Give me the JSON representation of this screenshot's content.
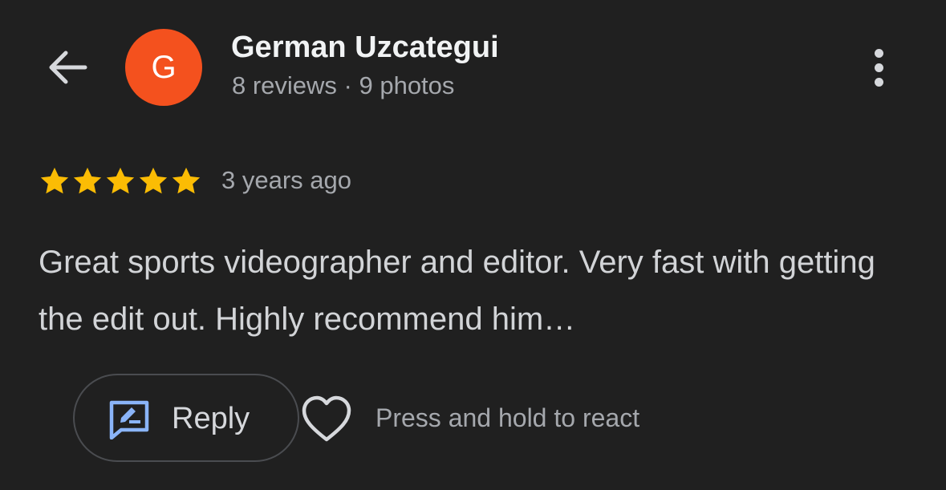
{
  "header": {
    "back_icon": "arrow-back-icon",
    "avatar_letter": "G",
    "avatar_color": "#f4511e",
    "name": "German Uzcategui",
    "meta": "8 reviews · 9 photos",
    "more_icon": "more-vert-icon"
  },
  "review": {
    "rating": 5,
    "rating_max": 5,
    "star_color": "#fbbc04",
    "time": "3 years ago",
    "text": "Great sports videographer and editor. Very fast with getting the edit out. Highly recommend him…"
  },
  "actions": {
    "reply_label": "Reply",
    "reply_icon": "reply-edit-icon",
    "reply_icon_color": "#8ab4f8",
    "heart_icon": "heart-outline-icon",
    "react_hint": "Press and hold to react"
  }
}
